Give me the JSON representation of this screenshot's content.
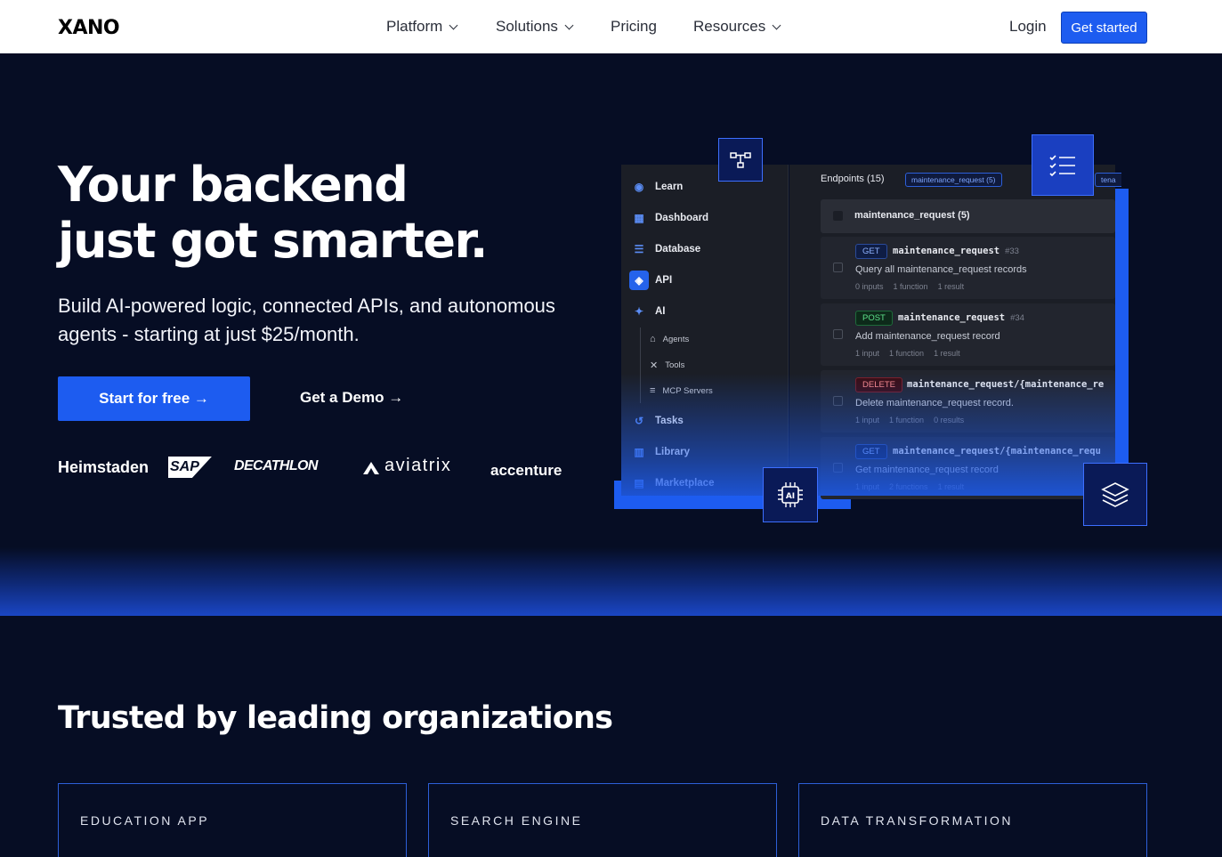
{
  "nav": {
    "logo": "XANO",
    "items": [
      {
        "label": "Platform",
        "dropdown": true
      },
      {
        "label": "Solutions",
        "dropdown": true
      },
      {
        "label": "Pricing",
        "dropdown": false
      },
      {
        "label": "Resources",
        "dropdown": true
      }
    ],
    "login": "Login",
    "get_started": "Get started"
  },
  "hero": {
    "title_line1": "Your backend",
    "title_line2": "just got smarter.",
    "subtitle": "Build AI-powered logic, connected APIs, and autonomous agents - starting at just $25/month.",
    "cta_primary": "Start for free →",
    "cta_secondary": "Get a Demo →",
    "brands": [
      "Heimstaden",
      "SAP",
      "DECATHLON",
      "aviatrix",
      "accenture"
    ]
  },
  "mockup": {
    "sidebar": [
      {
        "label": "Learn",
        "icon": "compass-icon"
      },
      {
        "label": "Dashboard",
        "icon": "dashboard-icon"
      },
      {
        "label": "Database",
        "icon": "database-icon"
      },
      {
        "label": "API",
        "icon": "stack-icon",
        "selected": true
      },
      {
        "label": "AI",
        "icon": "sparkle-icon"
      },
      {
        "label": "Agents",
        "icon": "robot-icon",
        "sub": true
      },
      {
        "label": "Tools",
        "icon": "tools-icon",
        "sub": true
      },
      {
        "label": "MCP Servers",
        "icon": "server-icon",
        "sub": true
      },
      {
        "label": "Tasks",
        "icon": "history-icon"
      },
      {
        "label": "Library",
        "icon": "library-icon"
      },
      {
        "label": "Marketplace",
        "icon": "store-icon"
      }
    ],
    "endpoints_title": "Endpoints (15)",
    "chips": [
      "maintenance_request (5)",
      "tena"
    ],
    "group": "maintenance_request (5)",
    "endpoints": [
      {
        "verb": "GET",
        "name": "maintenance_request",
        "num": "#33",
        "desc": "Query all maintenance_request records",
        "meta": [
          "0 inputs",
          "1 function",
          "1 result"
        ]
      },
      {
        "verb": "POST",
        "name": "maintenance_request",
        "num": "#34",
        "desc": "Add maintenance_request record",
        "meta": [
          "1 input",
          "1 function",
          "1 result"
        ]
      },
      {
        "verb": "DELETE",
        "name": "maintenance_request/{maintenance_re",
        "num": "",
        "desc": "Delete maintenance_request record.",
        "meta": [
          "1 input",
          "1 function",
          "0 results"
        ]
      },
      {
        "verb": "GET",
        "name": "maintenance_request/{maintenance_requ",
        "num": "",
        "desc": "Get maintenance_request record",
        "meta": [
          "1 input",
          "2 functions",
          "1 result"
        ]
      }
    ]
  },
  "trusted": {
    "title": "Trusted by leading organizations",
    "cards": [
      "EDUCATION APP",
      "SEARCH ENGINE",
      "DATA TRANSFORMATION"
    ]
  },
  "colors": {
    "accent": "#1d5cf0",
    "background": "#060d24",
    "panel": "#1b1e26"
  }
}
